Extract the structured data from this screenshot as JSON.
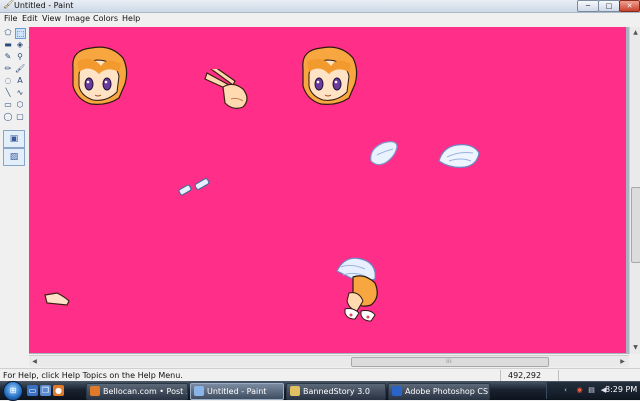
{
  "window": {
    "title": "Untitled - Paint",
    "app_icon": "paint-icon",
    "minimize_glyph": "─",
    "maximize_glyph": "□",
    "close_glyph": "✕"
  },
  "menu": {
    "items": [
      "File",
      "Edit",
      "View",
      "Image",
      "Colors",
      "Help"
    ]
  },
  "palette": {
    "foreground": "#ff2a86",
    "background": "#ffffff",
    "row1": [
      "#000000",
      "#808080",
      "#800000",
      "#808000",
      "#008000",
      "#008080",
      "#000080",
      "#800080",
      "#808040",
      "#004040",
      "#0080ff",
      "#004080",
      "#8000ff",
      "#804000",
      "#ff8040",
      "#ff0080",
      "#ffff00",
      "#ff8000"
    ],
    "row2": [
      "#ffffff",
      "#c0c0c0",
      "#ff0000",
      "#ffff00",
      "#00ff00",
      "#00ffff",
      "#0000ff",
      "#ff00ff",
      "#ffff80",
      "#00ff80",
      "#80ffff",
      "#8080ff",
      "#ff0080",
      "#ff8040",
      "#ff80c0",
      "#c0c0ff",
      "#e0e0e0",
      "#f0f0f0"
    ]
  },
  "toolbox": {
    "tools": [
      {
        "name": "free-form-select-icon",
        "glyph": "⬠"
      },
      {
        "name": "rect-select-icon",
        "glyph": "⬚"
      },
      {
        "name": "eraser-icon",
        "glyph": "▬"
      },
      {
        "name": "fill-bucket-icon",
        "glyph": "◈"
      },
      {
        "name": "color-picker-icon",
        "glyph": "✎"
      },
      {
        "name": "magnifier-icon",
        "glyph": "⚲"
      },
      {
        "name": "pencil-icon",
        "glyph": "✏"
      },
      {
        "name": "brush-icon",
        "glyph": "🖌"
      },
      {
        "name": "airbrush-icon",
        "glyph": "◌"
      },
      {
        "name": "text-icon",
        "glyph": "A"
      },
      {
        "name": "line-icon",
        "glyph": "╲"
      },
      {
        "name": "curve-icon",
        "glyph": "∿"
      },
      {
        "name": "rectangle-icon",
        "glyph": "▭"
      },
      {
        "name": "polygon-icon",
        "glyph": "⬡"
      },
      {
        "name": "ellipse-icon",
        "glyph": "◯"
      },
      {
        "name": "rounded-rect-icon",
        "glyph": "▢"
      }
    ],
    "option_glyphs": [
      "▣",
      "▨"
    ]
  },
  "canvas": {
    "background": "#ff2e88"
  },
  "status": {
    "help_text": "For Help, click Help Topics on the Help Menu.",
    "coords": "492,292"
  },
  "taskbar": {
    "start_icon": "windows-flag-icon",
    "quick_launch": [
      "show-desktop-icon",
      "switch-windows-icon",
      "firefox-icon"
    ],
    "tasks": [
      {
        "label": "Bellocan.com • Post ...",
        "icon_color": "#e07a2a",
        "active": false
      },
      {
        "label": "Untitled - Paint",
        "icon_color": "#8ab4e8",
        "active": true
      },
      {
        "label": "BannedStory 3.0",
        "icon_color": "#e0c060",
        "active": false
      },
      {
        "label": "Adobe Photoshop CS...",
        "icon_color": "#2a64c8",
        "active": false
      }
    ],
    "clock": "8:29 PM"
  }
}
